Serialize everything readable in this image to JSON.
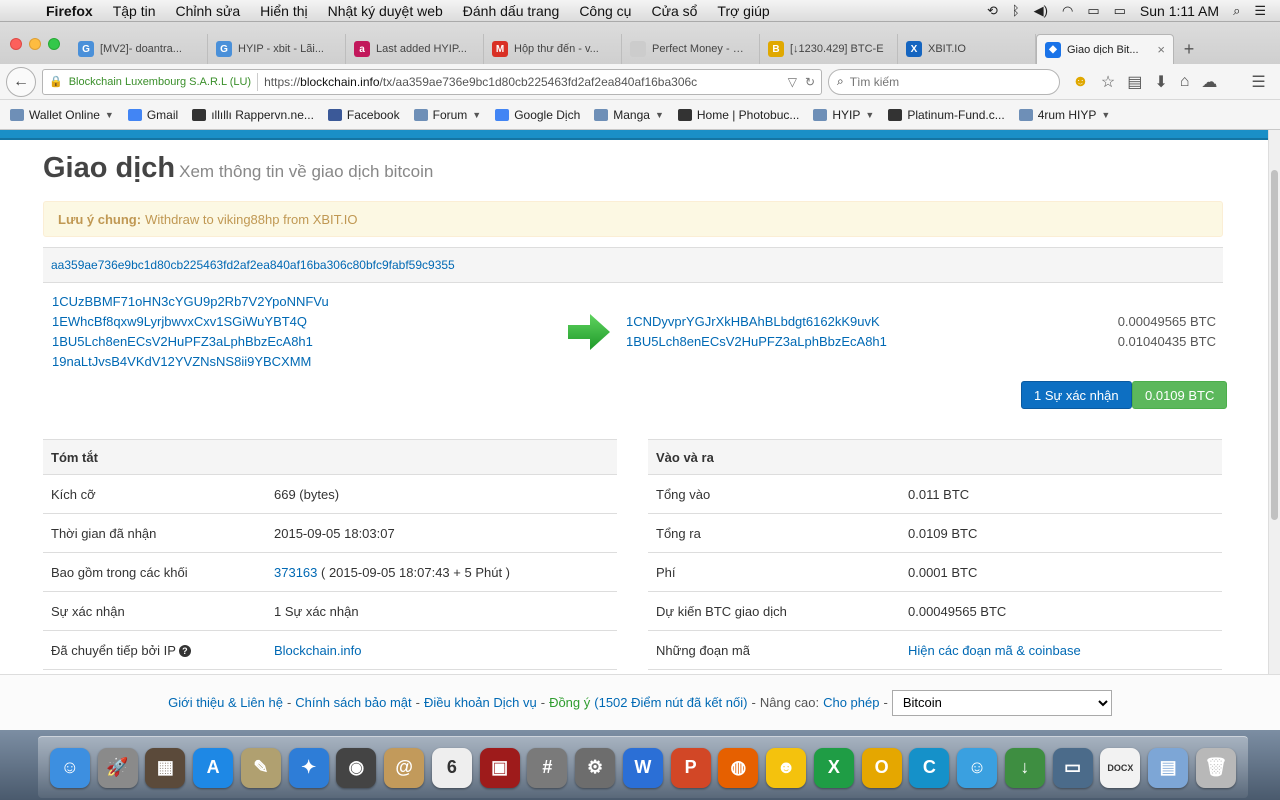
{
  "menubar": {
    "app": "Firefox",
    "items": [
      "Tập tin",
      "Chỉnh sửa",
      "Hiển thị",
      "Nhật ký duyệt web",
      "Đánh dấu trang",
      "Công cụ",
      "Cửa sổ",
      "Trợ giúp"
    ],
    "clock": "Sun 1:11 AM"
  },
  "tabs": [
    {
      "label": "[MV2]- doantra...",
      "color": "#4a90d9",
      "glyph": "G"
    },
    {
      "label": "HYIP - xbit - Lãi...",
      "color": "#4a90d9",
      "glyph": "G"
    },
    {
      "label": "Last added HYIP...",
      "color": "#c2185b",
      "glyph": "a"
    },
    {
      "label": "Hộp thư đến - v...",
      "color": "#d93025",
      "glyph": "M"
    },
    {
      "label": "Perfect Money - Way...",
      "color": "#cccccc",
      "glyph": ""
    },
    {
      "label": "[↓1230.429] BTC-E",
      "color": "#e0a800",
      "glyph": "B"
    },
    {
      "label": "XBIT.IO",
      "color": "#1565c0",
      "glyph": "X"
    },
    {
      "label": "Giao dịch Bit...",
      "color": "#1a73e8",
      "glyph": "◆",
      "active": true
    }
  ],
  "nav": {
    "org": "Blockchain Luxembourg S.A.R.L (LU)",
    "url_prefix": "https://",
    "url_domain": "blockchain.info",
    "url_path": "/tx/aa359ae736e9bc1d80cb225463fd2af2ea840af16ba306c",
    "search_placeholder": "Tìm kiếm"
  },
  "bookmarks": [
    {
      "label": "Wallet Online",
      "type": "folder",
      "caret": true
    },
    {
      "label": "Gmail",
      "type": "g"
    },
    {
      "label": "ıllıllı Rappervn.ne...",
      "type": "site"
    },
    {
      "label": "Facebook",
      "type": "fb"
    },
    {
      "label": "Forum",
      "type": "folder",
      "caret": true
    },
    {
      "label": "Google Dịch",
      "type": "g"
    },
    {
      "label": "Manga",
      "type": "folder",
      "caret": true
    },
    {
      "label": "Home | Photobuc...",
      "type": "site"
    },
    {
      "label": "HYIP",
      "type": "folder",
      "caret": true
    },
    {
      "label": "Platinum-Fund.c...",
      "type": "site"
    },
    {
      "label": "4rum HIYP",
      "type": "folder",
      "caret": true
    }
  ],
  "page": {
    "title": "Giao dịch",
    "subtitle": "Xem thông tin về giao dịch bitcoin",
    "notice_label": "Lưu ý chung:",
    "notice_text": "Withdraw to viking88hp from XBIT.IO",
    "tx_hash": "aa359ae736e9bc1d80cb225463fd2af2ea840af16ba306c80bfc9fabf59c9355",
    "inputs": [
      "1CUzBBMF71oHN3cYGU9p2Rb7V2YpoNNFVu",
      "1EWhcBf8qxw9LyrjbwvxCxv1SGiWuYBT4Q",
      "1BU5Lch8enECsV2HuPFZ3aLphBbzEcA8h1",
      "19naLtJvsB4VKdV12YVZNsNS8ii9YBCXMM"
    ],
    "outputs": [
      {
        "address": "1CNDyvprYGJrXkHBAhBLbdgt6162kK9uvK",
        "amount": "0.00049565 BTC"
      },
      {
        "address": "1BU5Lch8enECsV2HuPFZ3aLphBbzEcA8h1",
        "amount": "0.01040435 BTC"
      }
    ],
    "confirm_button": "1 Sự xác nhận",
    "amount_button": "0.0109 BTC",
    "summary": {
      "header": "Tóm tắt",
      "rows": [
        {
          "label": "Kích cỡ",
          "value": "669 (bytes)"
        },
        {
          "label": "Thời gian đã nhận",
          "value": "2015-09-05 18:03:07"
        },
        {
          "label": "Bao gồm trong các khối",
          "link": "373163",
          "value": " ( 2015-09-05 18:07:43 + 5 Phút )"
        },
        {
          "label": "Sự xác nhận",
          "value": "1 Sự xác nhận"
        },
        {
          "label": "Đã chuyển tiếp bởi IP",
          "link": "Blockchain.info",
          "value": ""
        }
      ]
    },
    "inout": {
      "header": "Vào và ra",
      "rows": [
        {
          "label": "Tổng vào",
          "value": "0.011 BTC"
        },
        {
          "label": "Tổng ra",
          "value": "0.0109 BTC"
        },
        {
          "label": "Phí",
          "value": "0.0001 BTC"
        },
        {
          "label": "Dự kiến BTC giao dịch",
          "value": "0.00049565 BTC"
        },
        {
          "label": "Những đoạn mã",
          "link": "Hiện các đoạn mã & coinbase",
          "value": ""
        }
      ]
    }
  },
  "footer": {
    "about": "Giới thiệu & Liên hệ",
    "privacy": "Chính sách bảo mật",
    "terms": "Điều khoản Dịch vụ",
    "consensus": "Đồng ý",
    "nodes": "(1502 Điểm nút đã kết nối)",
    "advanced_label": "Nâng cao:",
    "allow": "Cho phép",
    "currency_selected": "Bitcoin"
  },
  "dock": [
    {
      "name": "finder-icon",
      "color": "#3d8fe0",
      "glyph": "☺"
    },
    {
      "name": "launchpad-icon",
      "color": "#8a8a8a",
      "glyph": "🚀"
    },
    {
      "name": "mission-control-icon",
      "color": "#5b4a3a",
      "glyph": "▦"
    },
    {
      "name": "app-store-icon",
      "color": "#1e88e5",
      "glyph": "A"
    },
    {
      "name": "preview-icon",
      "color": "#b0a070",
      "glyph": "✎"
    },
    {
      "name": "safari-icon",
      "color": "#2e7dd7",
      "glyph": "✦"
    },
    {
      "name": "facetime-icon",
      "color": "#444444",
      "glyph": "◉"
    },
    {
      "name": "contacts-icon",
      "color": "#c29a5b",
      "glyph": "@"
    },
    {
      "name": "calendar-icon",
      "color": "#eeeeee",
      "glyph": "6",
      "dark": true
    },
    {
      "name": "photo-booth-icon",
      "color": "#9e1b1b",
      "glyph": "▣"
    },
    {
      "name": "calculator-icon",
      "color": "#7a7a7a",
      "glyph": "#"
    },
    {
      "name": "system-preferences-icon",
      "color": "#6d6d6d",
      "glyph": "⚙"
    },
    {
      "name": "word-icon",
      "color": "#2b6fd6",
      "glyph": "W"
    },
    {
      "name": "powerpoint-icon",
      "color": "#d24726",
      "glyph": "P"
    },
    {
      "name": "firefox-icon",
      "color": "#e66000",
      "glyph": "◍"
    },
    {
      "name": "chat-smiley-icon",
      "color": "#f4c20d",
      "glyph": "☻"
    },
    {
      "name": "excel-icon",
      "color": "#1f9d45",
      "glyph": "X"
    },
    {
      "name": "outlook-icon",
      "color": "#e5a700",
      "glyph": "O"
    },
    {
      "name": "c-app-icon",
      "color": "#1591c9",
      "glyph": "C"
    },
    {
      "name": "messenger-icon",
      "color": "#3aa0e0",
      "glyph": "☺"
    },
    {
      "name": "downloader-icon",
      "color": "#3e8e41",
      "glyph": "↓"
    },
    {
      "name": "screen-sharing-icon",
      "color": "#4b6b8a",
      "glyph": "▭"
    },
    {
      "name": "docx-file-icon",
      "color": "#f2f2f2",
      "glyph": "DOCX",
      "dark": true
    },
    {
      "name": "documents-folder-icon",
      "color": "#7da6d6",
      "glyph": "▤"
    },
    {
      "name": "trash-icon",
      "color": "#b8b8b8",
      "glyph": "🗑"
    }
  ]
}
